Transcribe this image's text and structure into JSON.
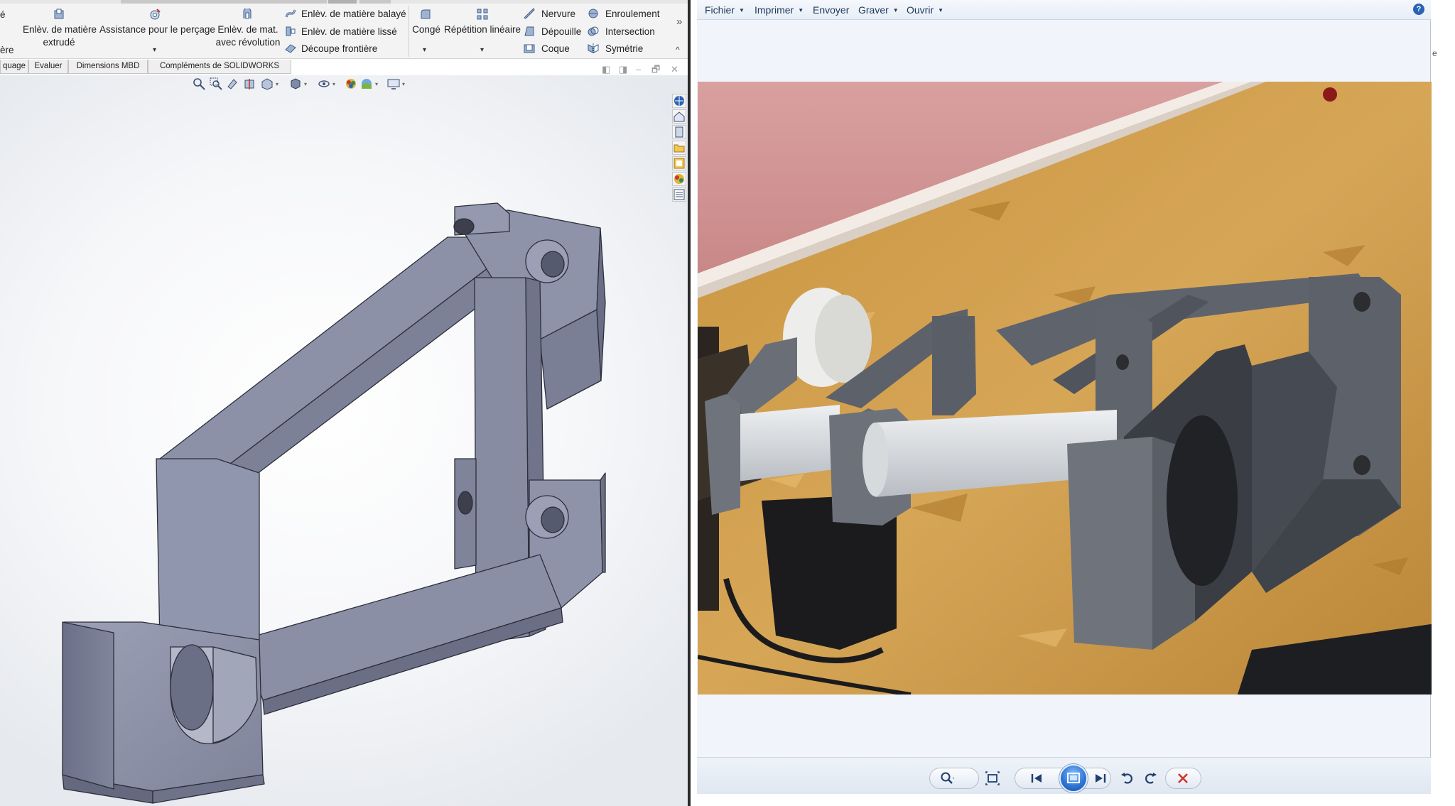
{
  "solidworks": {
    "ribbon": {
      "partial_left_top": "é",
      "partial_left_bottom": "ère",
      "extruded_cut": {
        "line1": "Enlèv. de matière",
        "line2": "extrudé"
      },
      "hole_wizard": {
        "label": "Assistance pour le perçage"
      },
      "revolved_cut": {
        "line1": "Enlèv. de mat.",
        "line2": "avec révolution"
      },
      "swept_cut": "Enlèv. de matière balayé",
      "lofted_cut": "Enlèv. de matière lissé",
      "boundary_cut": "Découpe frontière",
      "fillet": "Congé",
      "linear_pattern": "Répétition linéaire",
      "rib": "Nervure",
      "draft": "Dépouille",
      "shell": "Coque",
      "wrap": "Enroulement",
      "intersect": "Intersection",
      "mirror": "Symétrie",
      "more_chevron": "»",
      "collapse_chevron": "^"
    },
    "tabs": [
      "quage",
      "Evaluer",
      "Dimensions MBD",
      "Compléments de SOLIDWORKS"
    ],
    "window_controls": [
      "◧",
      "◨",
      "–",
      "🗗",
      "✕"
    ],
    "edge_letters": [
      "e",
      "l",
      "'"
    ]
  },
  "photo_viewer": {
    "menu": [
      "Fichier",
      "Imprimer",
      "Envoyer",
      "Graver",
      "Ouvrir"
    ],
    "help": "?",
    "edge_letters": [
      "e"
    ],
    "controls": {
      "zoom": "zoom-icon",
      "actual_size": "fit-window-icon",
      "previous": "previous-icon",
      "slideshow": "slideshow-icon",
      "next": "next-icon",
      "rotate_left": "rotate-counterclockwise-icon",
      "rotate_right": "rotate-clockwise-icon",
      "delete": "delete-icon"
    },
    "accent_color": "#2f77d6",
    "delete_color": "#d0352b"
  }
}
